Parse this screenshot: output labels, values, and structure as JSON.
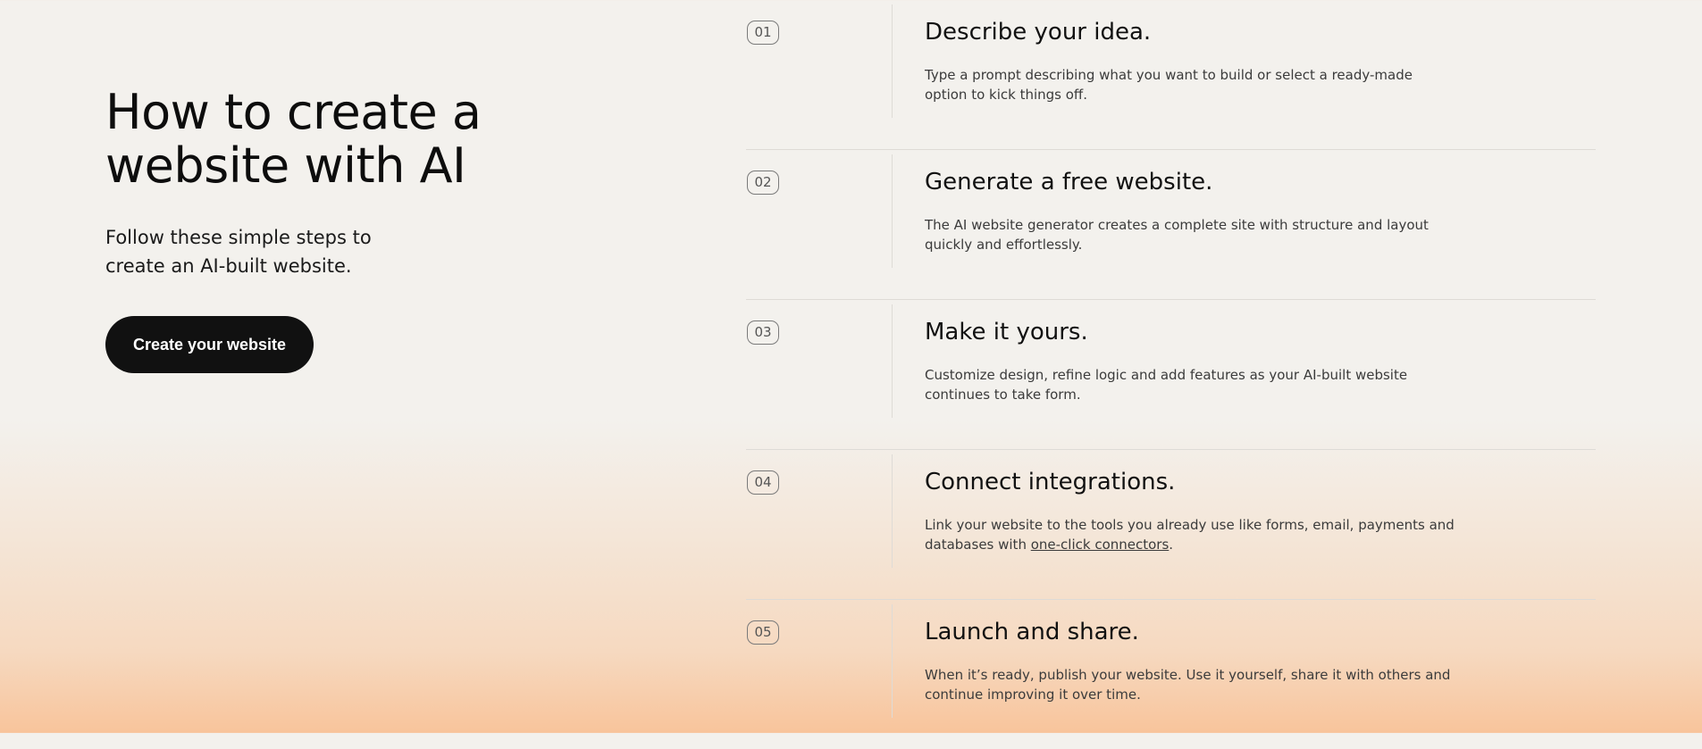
{
  "hero": {
    "title": "How to create a website with AI",
    "subtitle": "Follow these simple steps to create an AI-built website.",
    "cta_label": "Create your website"
  },
  "steps": [
    {
      "number": "01",
      "title": "Describe your idea.",
      "description": "Type a prompt describing what you want to build or select a ready-made option to kick things off."
    },
    {
      "number": "02",
      "title": "Generate a free website.",
      "description": "The AI website generator creates a complete site with structure and layout quickly and effortlessly."
    },
    {
      "number": "03",
      "title": "Make it yours.",
      "description": "Customize design, refine logic and add features as your AI-built website continues to take form."
    },
    {
      "number": "04",
      "title": "Connect integrations.",
      "description_before_link": "Link your website to the tools you already use like forms, email, payments and databases with ",
      "link_text": "one-click connectors",
      "description_after_link": "."
    },
    {
      "number": "05",
      "title": "Launch and share.",
      "description": "When it’s ready, publish your website. Use it yourself, share it with others and continue improving it over time."
    }
  ],
  "colors": {
    "background_top": "#f3f1ed",
    "background_bottom": "#f8c49b",
    "button_background": "#111111",
    "button_text": "#ffffff"
  }
}
